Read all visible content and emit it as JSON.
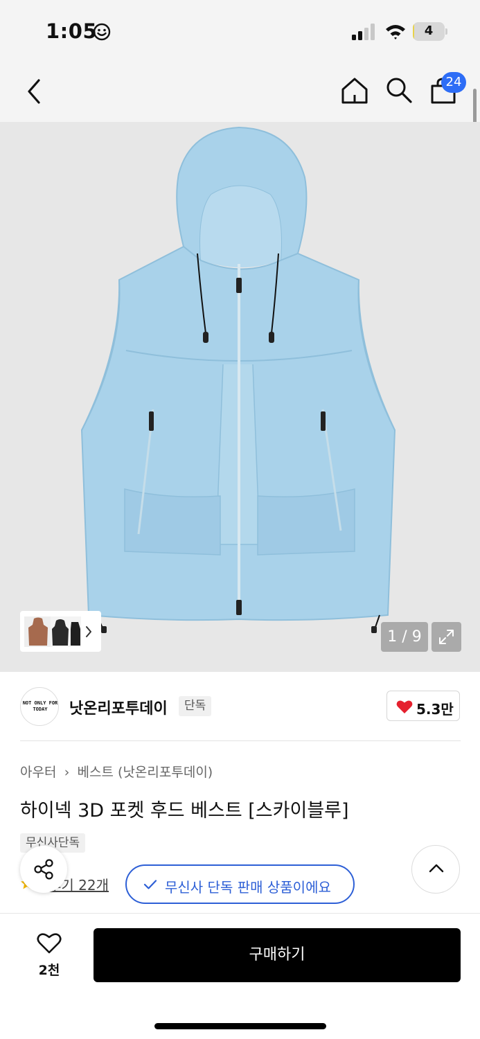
{
  "status_bar": {
    "time": "1:05",
    "battery_level": "4",
    "battery_color": "#e8d24a"
  },
  "nav": {
    "cart_count": "24",
    "icons": [
      "back-icon",
      "home-icon",
      "search-icon",
      "shopping-bag-icon"
    ]
  },
  "gallery": {
    "counter": "1 / 9",
    "expand_icon": "expand-icon",
    "thumbnails": [
      "brown-vest-thumbnail",
      "black-vest-thumbnail",
      "black-vest-thumbnail-2"
    ]
  },
  "brand": {
    "logo_text": "NOT ONLY FOR TODAY",
    "name": "낫온리포투데이",
    "tag": "단독",
    "likes": "5.3만"
  },
  "product": {
    "breadcrumb": [
      "아우터",
      "베스트 (낫온리포투데이)"
    ],
    "title": "하이넥 3D 포켓 후드 베스트 [스카이블루]",
    "exclusive_tag": "무신사단독",
    "review_text": "후기 22개",
    "verify_text": "무신사 단독 판매 상품이에요"
  },
  "bottom_bar": {
    "wish_count": "2천",
    "buy_label": "구매하기"
  },
  "colors": {
    "accent_blue": "#2d6df6",
    "verify_blue": "#2d5fd6",
    "heart_red": "#e5202e",
    "vest_sky_blue": "#a9d2ea"
  }
}
